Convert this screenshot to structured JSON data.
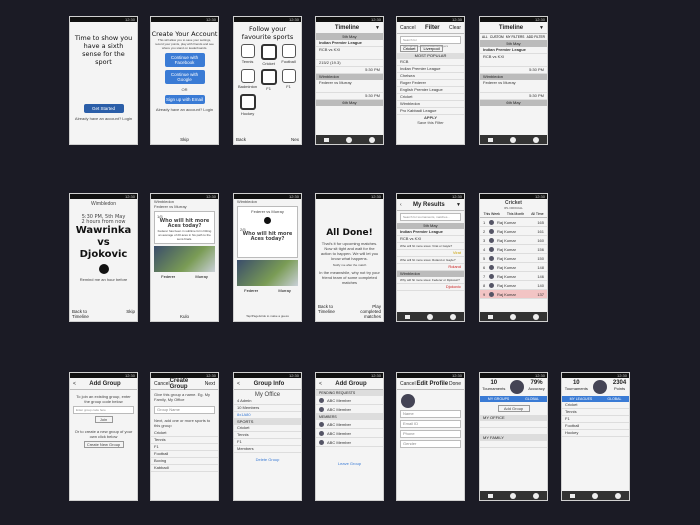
{
  "status_time": "12:30",
  "r1": {
    "onboard": {
      "headline": "Time to show you have a sixth sense for the sport",
      "cta": "Get Started",
      "login": "Already have an account? Login"
    },
    "create": {
      "title": "Create Your Account",
      "desc": "This will allow you to save your settings, record your points, play with friends and see where you stand on leaderboards.",
      "facebook": "Continue with Facebook",
      "google": "Continue with Google",
      "or": "OR",
      "email": "Sign up with Email",
      "login": "Already have an account? Login",
      "skip": "Skip"
    },
    "sports": {
      "title": "Follow your favourite sports",
      "back": "Back",
      "next": "Nex",
      "items": [
        "Tennis",
        "Cricket",
        "Football",
        "Badminton",
        "F1",
        "F1",
        "Hockey"
      ]
    },
    "timeline": {
      "title": "Timeline",
      "date1": "5th May",
      "league": "Indian Premier League",
      "match1": "RCB vs KXI",
      "score": "215/2 (19.3)",
      "time": "5:30 PM",
      "tourney": "Wimbledon",
      "match2": "Federer vs Murray",
      "time2": "5:30 PM",
      "date2": "6th May"
    },
    "filter": {
      "cancel": "Cancel",
      "title": "Filter",
      "clear": "Clear",
      "search": "Search for tournaments/sports/teams/players",
      "chips": [
        "Cricket",
        "Liverpool"
      ],
      "popular": "MOST POPULAR",
      "rows": [
        "RCB",
        "Indian Premier League",
        "Chelsea",
        "Roger Federer",
        "English Premier League",
        "Cricket",
        "Wimbledon",
        "Pro Kabbadi League"
      ],
      "apply": "APPLY",
      "save": "Save this Filter"
    },
    "timeline2": {
      "title": "Timeline",
      "tabs": [
        "ALL",
        "CUSTOM",
        "MY FILTERS",
        "ADD FILTER"
      ],
      "date1": "5th May",
      "league": "Indian Premier League",
      "match1": "RCB vs KXI",
      "time": "5:30 PM",
      "tourney": "Wimbledon",
      "match2": "Federer vs Murray",
      "time2": "5:30 PM",
      "date2": "6th May"
    }
  },
  "r2": {
    "match": {
      "title": "Wimbledon",
      "when": "5:30 PM, 5th May",
      "countdown": "2 hours from now",
      "p1": "Wawrinka",
      "vs": "vs",
      "p2": "Djokovic",
      "remind": "Remind me an hour before",
      "back": "Back to Timeline",
      "skip": "Skip"
    },
    "q1": {
      "title": "Wimbledon",
      "sub": "Federer vs Murray",
      "count": "1/5",
      "question": "Who will hit more Aces today?",
      "desc": "Federer has been in sublime form hitting an average of 20 aces in his path to the semi-finals.",
      "a": "Federer",
      "b": "Murray",
      "next": "Kulo"
    },
    "q2": {
      "title": "Wimbledon",
      "sub": "Federer vs Murray",
      "count": "2/5",
      "question": "Who will hit more Aces today?",
      "a": "Federer",
      "b": "Murray",
      "next": "Tap/Pagelstrok to make a guess"
    },
    "done": {
      "title": "All Done!",
      "body": "That's it for upcoming matches. Now sit tight and wait for the action to happen. We will let you know what happens.",
      "notify": "Notify me after the match",
      "meanwhile": "In the meanwhile, why not try your friend team of some completed matches",
      "back": "Back to Timeline",
      "play": "Play completed matches"
    },
    "results": {
      "title": "My Results",
      "search": "Search for tournaments, matches...",
      "date": "5th May",
      "league": "Indian Premier League",
      "match": "RCB vs KXI",
      "q1": "Who will hit more sixes: Virat or Gayle?",
      "a1": "Virat",
      "q2": "Who will hit more sixes: Roland or Gayle?",
      "a2": "Roland",
      "tourney": "Wimbledon",
      "q3": "Why will hit more sixes: Federer or Djokovic?",
      "a3": "Djokovic"
    },
    "leader": {
      "title": "Cricket",
      "sub": "IPL OFFICIAL",
      "tabs": [
        "This Week",
        "This Month",
        "All Time"
      ],
      "rows": [
        {
          "rank": "1",
          "name": "Raj Kumar",
          "pts": "165"
        },
        {
          "rank": "2",
          "name": "Raj Kumar",
          "pts": "161"
        },
        {
          "rank": "3",
          "name": "Raj Kumar",
          "pts": "160"
        },
        {
          "rank": "4",
          "name": "Raj Kumar",
          "pts": "156"
        },
        {
          "rank": "5",
          "name": "Raj Kumar",
          "pts": "150"
        },
        {
          "rank": "6",
          "name": "Raj Kumar",
          "pts": "148"
        },
        {
          "rank": "7",
          "name": "Raj Kumar",
          "pts": "146"
        },
        {
          "rank": "8",
          "name": "Raj Kumar",
          "pts": "140"
        },
        {
          "rank": "9",
          "name": "Raj Kumar",
          "pts": "137"
        }
      ]
    }
  },
  "r3": {
    "addgroup": {
      "back": "<",
      "title": "Add Group",
      "join": "To join an existing group, enter the group code below",
      "placeholder": "Enter group code here",
      "join_btn": "Join",
      "or": "Or to create a new group of your own click below",
      "create": "Create New Group"
    },
    "creategroup": {
      "cancel": "Cancel",
      "title": "Create Group",
      "next": "Next",
      "prompt": "Give this group a name. Eg. My Family, My Office",
      "name_ph": "Group Name",
      "sports_prompt": "Next, add one or more sports to this group",
      "sports": [
        "Cricket",
        "Tennis",
        "F1",
        "Football",
        "Boxing",
        "Kabbadi"
      ]
    },
    "groupinfo": {
      "back": "<",
      "title": "Group Info",
      "name": "My Office",
      "stats": [
        "4 Admin",
        "10 Members"
      ],
      "code": "8x1A80",
      "sports_h": "SPORTS",
      "sports": [
        "Cricket",
        "Tennis",
        "F1"
      ],
      "members_h": "Members",
      "delete": "Delete Group"
    },
    "addgroup2": {
      "back": "<",
      "title": "Add Group",
      "pending_h": "PENDING REQUESTS",
      "pending": [
        "ABC Member",
        "ABC Member"
      ],
      "members_h": "MEMBERS",
      "members": [
        "ABC Member",
        "ABC Member",
        "ABC Member"
      ],
      "leave": "Leave Group"
    },
    "editprofile": {
      "cancel": "Cancel",
      "title": "Edit Profile",
      "done": "Done",
      "fields": [
        "Name",
        "Email ID",
        "Phone",
        "Gender"
      ]
    },
    "profile": {
      "stat1": "10",
      "stat1_l": "Tournaments",
      "stat2": "79%",
      "stat2_l": "Accuracy",
      "tabs": [
        "MY GROUPS",
        "GLOBAL"
      ],
      "add": "Add Group",
      "groups": [
        "MY OFFICE",
        "MY FAMILY"
      ]
    },
    "profile2": {
      "stat1": "10",
      "stat1_l": "Tournaments",
      "stat2": "2304",
      "stat2_l": "Points",
      "tabs": [
        "MY LEAGUES",
        "GLOBAL"
      ],
      "rows": [
        "Cricket",
        "Tennis",
        "F1",
        "Football",
        "Hockey"
      ]
    }
  }
}
